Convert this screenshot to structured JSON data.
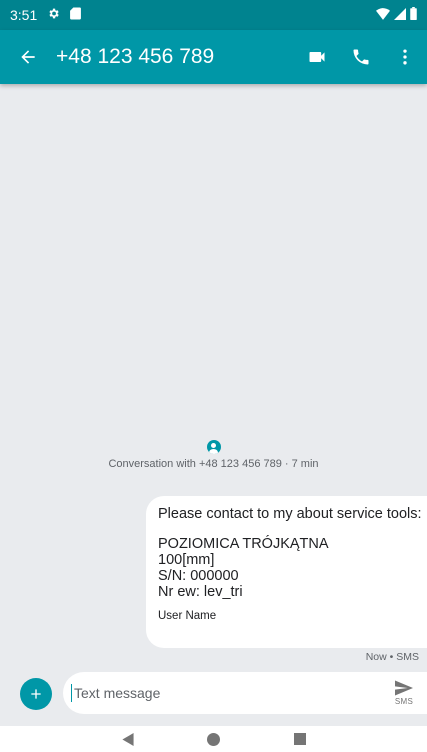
{
  "status_bar": {
    "time": "3:51"
  },
  "app_bar": {
    "contact": "+48 123 456 789"
  },
  "conversation": {
    "info": "Conversation with +48 123 456 789 · 7 min"
  },
  "message": {
    "line_1": "Please contact to my about service tools:",
    "body_lines": [
      "POZIOMICA TRÓJKĄTNA",
      "100[mm]",
      "S/N:  000000",
      "Nr ew: lev_tri"
    ],
    "signature": "User Name",
    "meta": "Now • SMS"
  },
  "compose": {
    "placeholder": "Text message",
    "send_label": "SMS"
  },
  "colors": {
    "status_bar": "#00838f",
    "app_bar": "#0097a7",
    "background": "#e9ebee",
    "bubble": "#ffffff"
  },
  "icons": {
    "status_left": [
      "gear-icon",
      "sd-card-icon"
    ],
    "status_right": [
      "wifi-icon",
      "signal-icon",
      "battery-icon"
    ],
    "app_bar": [
      "arrow-back-icon",
      "videocam-icon",
      "phone-icon",
      "more-vert-icon"
    ],
    "compose": [
      "add-icon",
      "send-icon"
    ],
    "nav": [
      "nav-back-icon",
      "nav-home-icon",
      "nav-recents-icon"
    ]
  }
}
